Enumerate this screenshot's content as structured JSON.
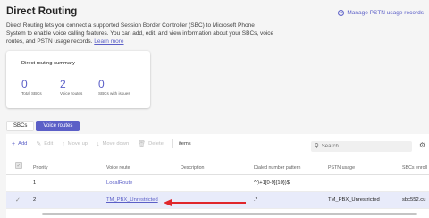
{
  "page": {
    "title": "Direct Routing",
    "manage_link": "Manage PSTN usage records",
    "description": "Direct Routing lets you connect a supported Session Border Controller (SBC) to Microsoft Phone System to enable voice calling features. You can add, edit, and view information about your SBCs, voice routes, and PSTN usage records.",
    "learn_more": "Learn more"
  },
  "summary": {
    "title": "Direct routing summary",
    "stats": [
      {
        "value": "0",
        "label": "Total SBCs"
      },
      {
        "value": "2",
        "label": "Voice routes"
      },
      {
        "value": "0",
        "label": "SBCs with issues"
      }
    ]
  },
  "tabs": [
    {
      "label": "SBCs",
      "active": false
    },
    {
      "label": "Voice routes",
      "active": true
    }
  ],
  "toolbar": {
    "add": "Add",
    "edit": "Edit",
    "move_up": "Move up",
    "move_down": "Move down",
    "delete": "Delete",
    "items": "items",
    "search_placeholder": "Search"
  },
  "table": {
    "columns": [
      "Priority",
      "Voice route",
      "Description",
      "Dialed number pattern",
      "PSTN usage",
      "SBCs enroll"
    ],
    "rows": [
      {
        "priority": "1",
        "voice_route": "LocalRoute",
        "description": "",
        "pattern": "^(\\+1[0-9]{10})$",
        "pstn_usage": "",
        "sbcs": "",
        "selected": false
      },
      {
        "priority": "2",
        "voice_route": "TM_PBX_Unrestricted",
        "description": "",
        "pattern": ".*",
        "pstn_usage": "TM_PBX_Unrestricted",
        "sbcs": "sbc552.cu",
        "selected": true
      }
    ]
  },
  "colors": {
    "accent": "#5b5fc7",
    "arrow": "#e0262b",
    "selected_row": "#e8ebfa"
  },
  "icons": {
    "manage": "circle-plus-icon",
    "add": "plus-icon",
    "edit": "pencil-icon",
    "move_up": "arrow-up-icon",
    "move_down": "arrow-down-icon",
    "delete": "trash-icon",
    "search": "search-icon",
    "settings": "gear-icon",
    "row_check": "checkmark-icon"
  }
}
